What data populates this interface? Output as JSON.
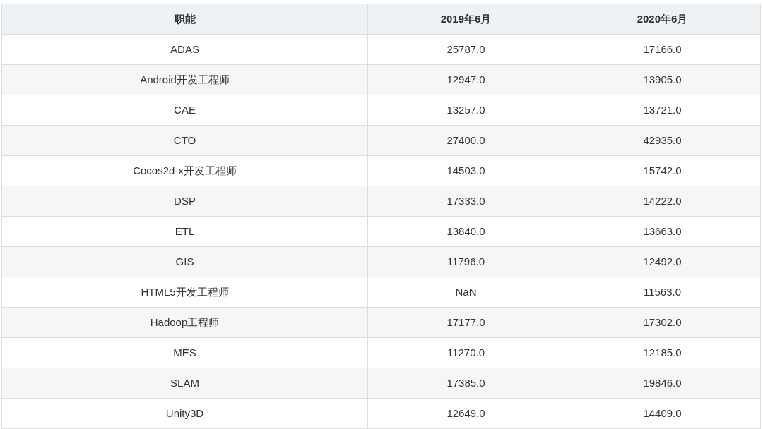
{
  "table": {
    "columns": [
      "职能",
      "2019年6月",
      "2020年6月"
    ],
    "rows": [
      [
        "ADAS",
        "25787.0",
        "17166.0"
      ],
      [
        "Android开发工程师",
        "12947.0",
        "13905.0"
      ],
      [
        "CAE",
        "13257.0",
        "13721.0"
      ],
      [
        "CTO",
        "27400.0",
        "42935.0"
      ],
      [
        "Cocos2d-x开发工程师",
        "14503.0",
        "15742.0"
      ],
      [
        "DSP",
        "17333.0",
        "14222.0"
      ],
      [
        "ETL",
        "13840.0",
        "13663.0"
      ],
      [
        "GIS",
        "11796.0",
        "12492.0"
      ],
      [
        "HTML5开发工程师",
        "NaN",
        "11563.0"
      ],
      [
        "Hadoop工程师",
        "17177.0",
        "17302.0"
      ],
      [
        "MES",
        "11270.0",
        "12185.0"
      ],
      [
        "SLAM",
        "17385.0",
        "19846.0"
      ],
      [
        "Unity3D",
        "12649.0",
        "14409.0"
      ]
    ]
  }
}
